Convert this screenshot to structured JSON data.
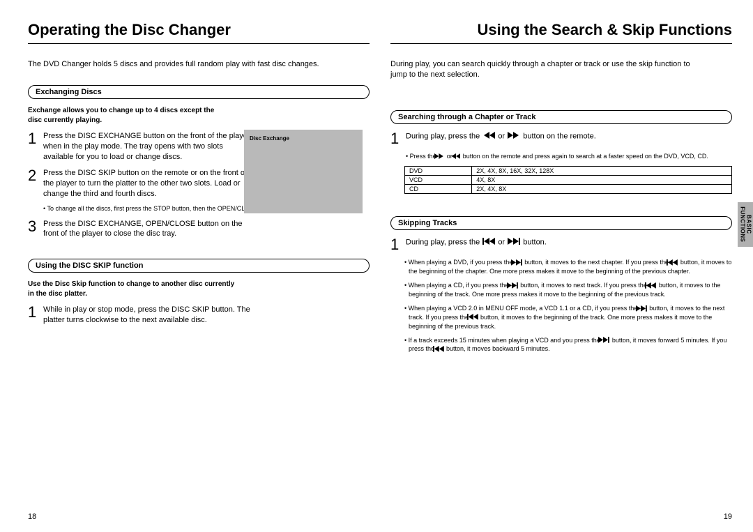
{
  "left": {
    "title": "Operating the Disc Changer",
    "intro": "The DVD Changer holds 5 discs and provides full random play with fast disc changes.",
    "sec1": {
      "head": "Exchanging Discs",
      "bold": "Exchange allows you to change up to 4 discs except the  disc currently playing.",
      "s1": "Press the DISC EXCHANGE button on the front of the player when in the play mode. The tray opens with two slots available for you to load or change discs.",
      "s2": "Press the DISC SKIP button on the remote or on the front of the player to turn the platter to the other two slots. Load or change the third and fourth discs.",
      "note2": "To change all the discs, first press the STOP button, then the OPEN/CLOSE and DISC SKIP buttons.",
      "s3": "Press the DISC EXCHANGE, OPEN/CLOSE button on the front of the player to close the disc tray."
    },
    "sec2": {
      "head": "Using the DISC SKIP function",
      "bold": "Use the Disc Skip function to change to another disc currently in the disc platter.",
      "s1": "While in play or stop mode, press the DISC SKIP button. The platter turns clockwise to the next available disc."
    },
    "imgLabel": "Disc Exchange",
    "pagenum": "18"
  },
  "right": {
    "title": "Using the Search & Skip Functions",
    "intro": "During play, you can search quickly through a chapter or track or use the skip function to jump to the next selection.",
    "sec1": {
      "head": "Searching through a Chapter or Track",
      "s1a": "During play, press the ",
      "s1mid": " or ",
      "s1b": " button on the remote.",
      "noteA_a": "Press the ",
      "noteA_b": " or ",
      "noteA_c": " button on the remote and press again to search at a faster speed on the DVD, VCD, CD.",
      "rows": [
        [
          "DVD",
          "2X, 4X, 8X, 16X, 32X, 128X"
        ],
        [
          "VCD",
          "4X, 8X"
        ],
        [
          "CD",
          "2X, 4X, 8X"
        ]
      ]
    },
    "sec2": {
      "head": "Skipping Tracks",
      "s1a": "During play, press the ",
      "s1mid": " or ",
      "s1b": " button.",
      "b1a": "When playing a DVD, if you press the ",
      "b1b": " button, it moves to the next chapter. If you press the ",
      "b1c": " button, it moves to the beginning of the chapter. One more press makes it move to the beginning of the previous chapter.",
      "b2a": "When playing a CD, if you press the ",
      "b2b": " button, it moves to next track. If you press the ",
      "b2c": " button, it moves to the beginning of the track. One more press makes it move to the beginning of the previous track.",
      "b3a": "When playing a VCD 2.0 in MENU OFF mode, a VCD 1.1 or a CD, if you press the ",
      "b3b": " button, it moves to the next track. If you press the ",
      "b3c": " button, it moves to the beginning of the track. One more press makes it move to the beginning of the previous track.",
      "b4a": "If a track exceeds 15 minutes when playing a VCD and you press the ",
      "b4b": " button, it moves forward 5 minutes. If you press the ",
      "b4c": " button, it moves backward 5 minutes."
    },
    "tab": "BASIC FUNCTIONS",
    "pagenum": "19"
  },
  "icons": {
    "rew": "rewind-icon",
    "ff": "fast-forward-icon",
    "prev": "skip-prev-icon",
    "next": "skip-next-icon"
  }
}
